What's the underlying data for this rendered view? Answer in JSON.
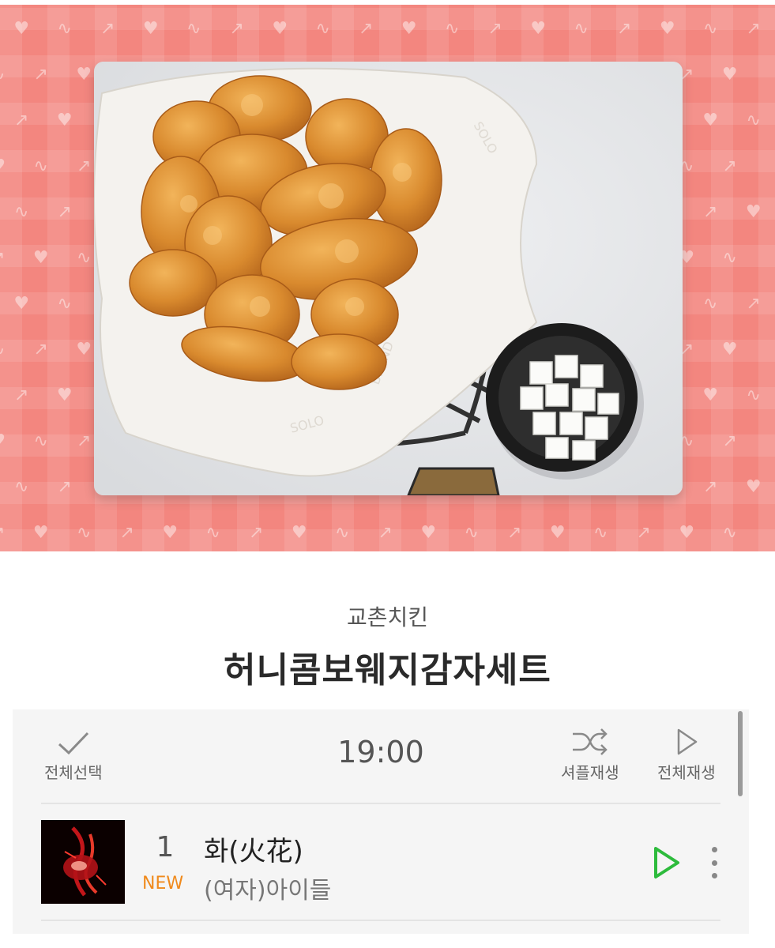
{
  "banner": {
    "background_color": "#f3867f",
    "pattern_icons": [
      "heart-letter-icon",
      "heartbeat-icon",
      "arrow-icon"
    ],
    "image": "fried-chicken-basket-with-pickled-radish"
  },
  "brand": "교촌치킨",
  "title": "허니콤보웨지감자세트",
  "controls": {
    "select_all_label": "전체선택",
    "duration": "19:00",
    "shuffle_label": "셔플재생",
    "play_all_label": "전체재생"
  },
  "tracks": [
    {
      "rank": "1",
      "badge": "NEW",
      "title": "화(火花)",
      "artist": "(여자)아이들"
    }
  ],
  "colors": {
    "accent_play": "#2dbb3c",
    "new_badge": "#f08a1c",
    "banner": "#f3867f"
  }
}
